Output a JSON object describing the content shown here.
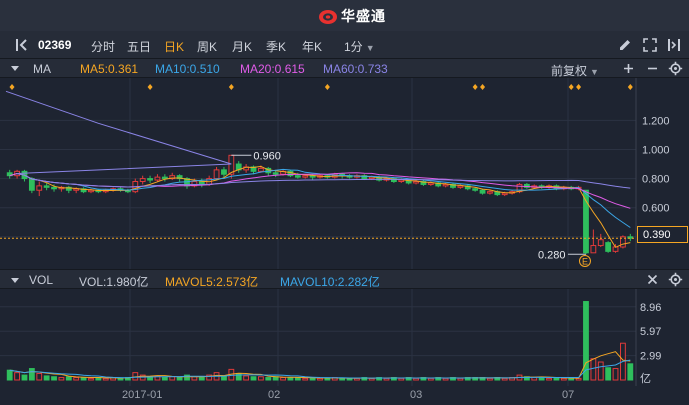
{
  "brand": {
    "name": "华盛通",
    "logo_icon": "huasheng-logo-icon"
  },
  "toolbar": {
    "stock_code": "02369",
    "periods": [
      {
        "label": "分时",
        "active": false
      },
      {
        "label": "五日",
        "active": false
      },
      {
        "label": "日K",
        "active": true
      },
      {
        "label": "周K",
        "active": false
      },
      {
        "label": "月K",
        "active": false
      },
      {
        "label": "季K",
        "active": false
      },
      {
        "label": "年K",
        "active": false
      },
      {
        "label": "1分",
        "active": false
      }
    ],
    "icons": [
      "collapse-panel-icon",
      "pencil-icon",
      "fullscreen-icon",
      "layout-icon"
    ]
  },
  "main_header": {
    "indicator": "MA",
    "ma5": "MA5:0.361",
    "ma10": "MA10:0.510",
    "ma20": "MA20:0.615",
    "ma60": "MA60:0.733",
    "adjust": "前复权",
    "icons": [
      "chevron-down-icon",
      "plus-icon",
      "minus-icon",
      "settings-gear-icon"
    ]
  },
  "vol_header": {
    "indicator": "VOL",
    "vol": "VOL:1.980亿",
    "mavol5": "MAVOL5:2.573亿",
    "mavol10": "MAVOL10:2.282亿",
    "icons": [
      "chevron-down-icon",
      "close-icon",
      "settings-gear-icon"
    ]
  },
  "colors": {
    "up": "#e03a3a",
    "down": "#2fbf5d",
    "ma5": "#f5a623",
    "ma10": "#3ba7e8",
    "ma20": "#e05ce8",
    "ma60": "#8a84e6",
    "background": "#1e2431"
  },
  "chart_data": {
    "type": "candlestick",
    "price_axis_ticks": [
      "1.200",
      "1.000",
      "0.800",
      "0.600",
      "0.400"
    ],
    "price_range": [
      0.22,
      1.45
    ],
    "annotations": {
      "high": "0.960",
      "low": "0.280",
      "current_price": "0.390",
      "event_marker": "E"
    },
    "date_ticks": [
      "2017-01",
      "02",
      "03",
      "07"
    ],
    "volume_axis_ticks": [
      "8.96",
      "5.97",
      "2.99",
      "亿"
    ],
    "volume_range": [
      0,
      10.4
    ],
    "last_values": {
      "MA5": 0.361,
      "MA10": 0.51,
      "MA20": 0.615,
      "MA60": 0.733,
      "VOL": 1.98,
      "MAVOL5": 2.573,
      "MAVOL10": 2.282
    },
    "candles_approx": [
      [
        0.84,
        0.82,
        0.86,
        0.8,
        1.2
      ],
      [
        0.82,
        0.85,
        0.86,
        0.8,
        0.9
      ],
      [
        0.85,
        0.8,
        0.86,
        0.78,
        0.6
      ],
      [
        0.8,
        0.72,
        0.81,
        0.7,
        1.4
      ],
      [
        0.72,
        0.75,
        0.78,
        0.68,
        0.8
      ],
      [
        0.75,
        0.74,
        0.77,
        0.72,
        0.5
      ],
      [
        0.74,
        0.73,
        0.76,
        0.71,
        0.4
      ],
      [
        0.73,
        0.74,
        0.75,
        0.71,
        0.3
      ],
      [
        0.74,
        0.72,
        0.75,
        0.7,
        0.4
      ],
      [
        0.72,
        0.73,
        0.74,
        0.7,
        0.3
      ],
      [
        0.73,
        0.71,
        0.74,
        0.7,
        0.3
      ],
      [
        0.71,
        0.72,
        0.73,
        0.7,
        0.2
      ],
      [
        0.72,
        0.71,
        0.73,
        0.7,
        0.3
      ],
      [
        0.71,
        0.72,
        0.73,
        0.7,
        0.2
      ],
      [
        0.72,
        0.73,
        0.74,
        0.71,
        0.3
      ],
      [
        0.73,
        0.72,
        0.74,
        0.71,
        0.2
      ],
      [
        0.72,
        0.71,
        0.73,
        0.7,
        0.3
      ],
      [
        0.71,
        0.78,
        0.8,
        0.7,
        0.9
      ],
      [
        0.78,
        0.8,
        0.82,
        0.76,
        0.6
      ],
      [
        0.8,
        0.79,
        0.82,
        0.77,
        0.4
      ],
      [
        0.79,
        0.81,
        0.83,
        0.78,
        0.5
      ],
      [
        0.81,
        0.8,
        0.83,
        0.78,
        0.3
      ],
      [
        0.8,
        0.82,
        0.84,
        0.79,
        0.4
      ],
      [
        0.82,
        0.8,
        0.83,
        0.78,
        0.3
      ],
      [
        0.8,
        0.75,
        0.81,
        0.73,
        0.6
      ],
      [
        0.75,
        0.78,
        0.8,
        0.74,
        0.4
      ],
      [
        0.78,
        0.76,
        0.8,
        0.74,
        0.3
      ],
      [
        0.76,
        0.8,
        0.82,
        0.75,
        0.6
      ],
      [
        0.8,
        0.86,
        0.88,
        0.79,
        0.9
      ],
      [
        0.86,
        0.83,
        0.88,
        0.8,
        0.5
      ],
      [
        0.83,
        0.96,
        0.96,
        0.8,
        1.3
      ],
      [
        0.9,
        0.86,
        0.92,
        0.84,
        0.8
      ],
      [
        0.86,
        0.88,
        0.9,
        0.84,
        0.5
      ],
      [
        0.88,
        0.85,
        0.89,
        0.83,
        0.4
      ],
      [
        0.85,
        0.87,
        0.89,
        0.84,
        0.4
      ],
      [
        0.87,
        0.84,
        0.88,
        0.82,
        0.3
      ],
      [
        0.84,
        0.83,
        0.86,
        0.81,
        0.4
      ],
      [
        0.83,
        0.85,
        0.86,
        0.82,
        0.3
      ],
      [
        0.85,
        0.82,
        0.86,
        0.81,
        0.3
      ],
      [
        0.82,
        0.81,
        0.84,
        0.8,
        0.3
      ],
      [
        0.81,
        0.82,
        0.83,
        0.8,
        0.2
      ],
      [
        0.82,
        0.81,
        0.83,
        0.79,
        0.3
      ],
      [
        0.81,
        0.82,
        0.83,
        0.8,
        0.2
      ],
      [
        0.82,
        0.81,
        0.83,
        0.8,
        0.2
      ],
      [
        0.81,
        0.83,
        0.84,
        0.8,
        0.3
      ],
      [
        0.83,
        0.82,
        0.84,
        0.8,
        0.2
      ],
      [
        0.82,
        0.81,
        0.83,
        0.8,
        0.2
      ],
      [
        0.81,
        0.82,
        0.83,
        0.8,
        0.2
      ],
      [
        0.82,
        0.8,
        0.83,
        0.79,
        0.3
      ],
      [
        0.8,
        0.81,
        0.82,
        0.79,
        0.2
      ],
      [
        0.81,
        0.79,
        0.82,
        0.78,
        0.3
      ],
      [
        0.79,
        0.8,
        0.81,
        0.78,
        0.2
      ],
      [
        0.8,
        0.78,
        0.81,
        0.77,
        0.3
      ],
      [
        0.78,
        0.79,
        0.8,
        0.77,
        0.2
      ],
      [
        0.79,
        0.77,
        0.8,
        0.76,
        0.3
      ],
      [
        0.77,
        0.78,
        0.79,
        0.76,
        0.2
      ],
      [
        0.78,
        0.76,
        0.79,
        0.75,
        0.3
      ],
      [
        0.76,
        0.77,
        0.78,
        0.75,
        0.2
      ],
      [
        0.77,
        0.75,
        0.78,
        0.74,
        0.3
      ],
      [
        0.75,
        0.76,
        0.77,
        0.74,
        0.2
      ],
      [
        0.76,
        0.74,
        0.77,
        0.73,
        0.3
      ],
      [
        0.74,
        0.75,
        0.76,
        0.73,
        0.2
      ],
      [
        0.75,
        0.73,
        0.76,
        0.72,
        0.3
      ],
      [
        0.73,
        0.72,
        0.74,
        0.71,
        0.3
      ],
      [
        0.72,
        0.7,
        0.73,
        0.69,
        0.3
      ],
      [
        0.7,
        0.71,
        0.72,
        0.69,
        0.2
      ],
      [
        0.71,
        0.69,
        0.72,
        0.68,
        0.3
      ],
      [
        0.69,
        0.7,
        0.71,
        0.68,
        0.2
      ],
      [
        0.7,
        0.71,
        0.72,
        0.69,
        0.3
      ],
      [
        0.71,
        0.76,
        0.77,
        0.7,
        0.6
      ],
      [
        0.76,
        0.74,
        0.77,
        0.73,
        0.4
      ],
      [
        0.74,
        0.75,
        0.76,
        0.73,
        0.3
      ],
      [
        0.75,
        0.74,
        0.76,
        0.73,
        0.3
      ],
      [
        0.74,
        0.75,
        0.76,
        0.73,
        0.2
      ],
      [
        0.75,
        0.73,
        0.76,
        0.72,
        0.3
      ],
      [
        0.73,
        0.74,
        0.75,
        0.72,
        0.2
      ],
      [
        0.74,
        0.73,
        0.75,
        0.72,
        0.2
      ],
      [
        0.73,
        0.74,
        0.75,
        0.72,
        0.2
      ],
      [
        0.72,
        0.29,
        0.49,
        0.28,
        9.6
      ],
      [
        0.29,
        0.34,
        0.45,
        0.29,
        2.6
      ],
      [
        0.34,
        0.38,
        0.42,
        0.33,
        2.2
      ],
      [
        0.36,
        0.3,
        0.37,
        0.29,
        1.5
      ],
      [
        0.3,
        0.33,
        0.35,
        0.29,
        1.4
      ],
      [
        0.33,
        0.4,
        0.41,
        0.32,
        4.5
      ],
      [
        0.4,
        0.39,
        0.42,
        0.37,
        1.98
      ]
    ]
  }
}
